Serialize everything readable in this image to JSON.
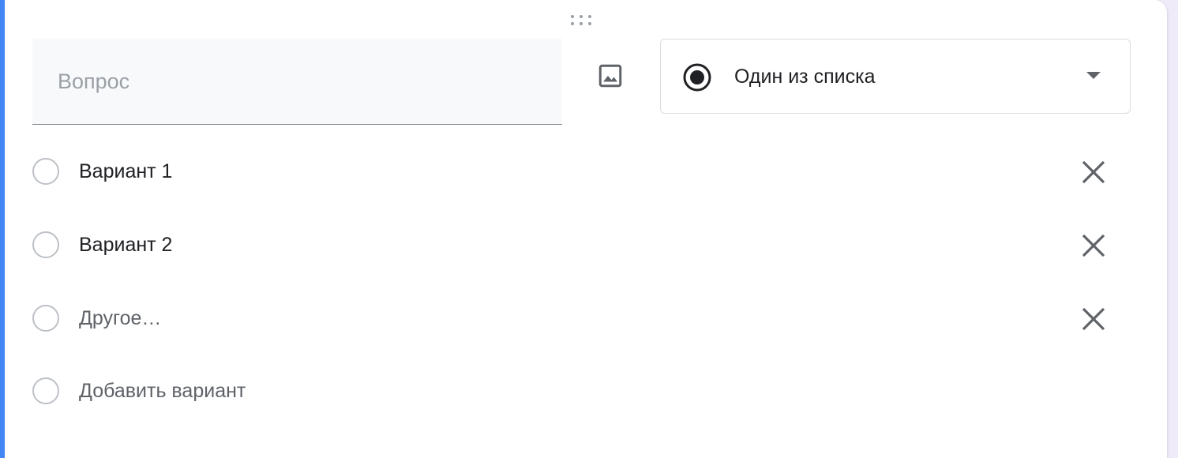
{
  "question": {
    "placeholder": "Вопрос",
    "value": ""
  },
  "image_button": {
    "icon": "image-icon"
  },
  "type_select": {
    "icon": "radio-checked-icon",
    "selected": "Один из списка",
    "dropdown_icon": "arrow-drop-down-icon"
  },
  "options": [
    {
      "label": "Вариант 1",
      "remove_icon": "close-icon"
    },
    {
      "label": "Вариант 2",
      "remove_icon": "close-icon"
    }
  ],
  "other_option": {
    "label": "Другое…",
    "remove_icon": "close-icon"
  },
  "add_option": {
    "label": "Добавить вариант"
  },
  "colors": {
    "accent": "#4285f4",
    "icon": "#5f6368",
    "radio_border": "#bdc1c6",
    "field_bg": "#f8f9fa"
  }
}
